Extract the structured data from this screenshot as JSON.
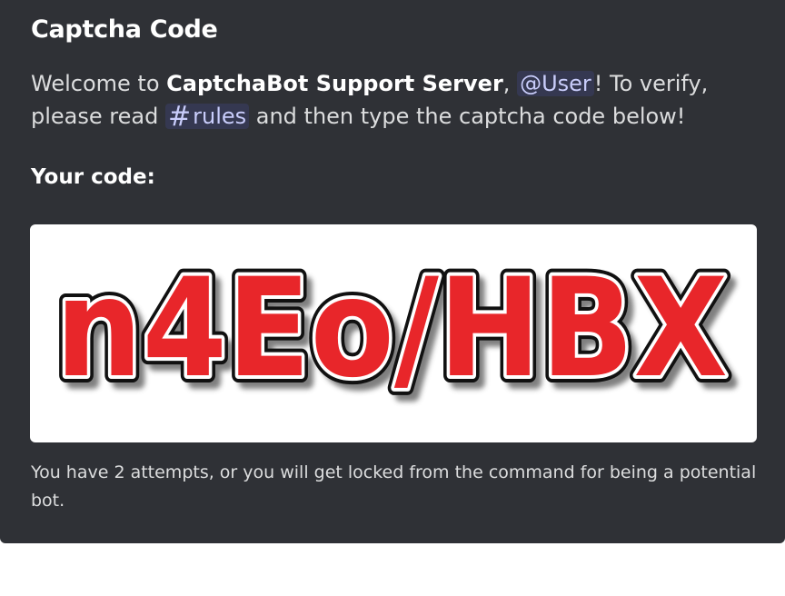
{
  "embed": {
    "title": "Captcha Code",
    "description": {
      "welcome": "Welcome to",
      "server_name": "CaptchaBot Support Server",
      "comma": ",",
      "user_mention": "@User",
      "after_mention": "! To verify, please read",
      "channel_hash": "#",
      "channel_name": "rules",
      "after_channel": "and then type the captcha code below!"
    },
    "field_label": "Your code:",
    "captcha_text": "n4Eo/HBX",
    "footer": "You have 2 attempts, or you will get locked from the command for being a potential bot."
  },
  "colors": {
    "embed_bg": "#2f3136",
    "captcha_fill": "#e8262a",
    "mention": "#c9cdfb"
  }
}
